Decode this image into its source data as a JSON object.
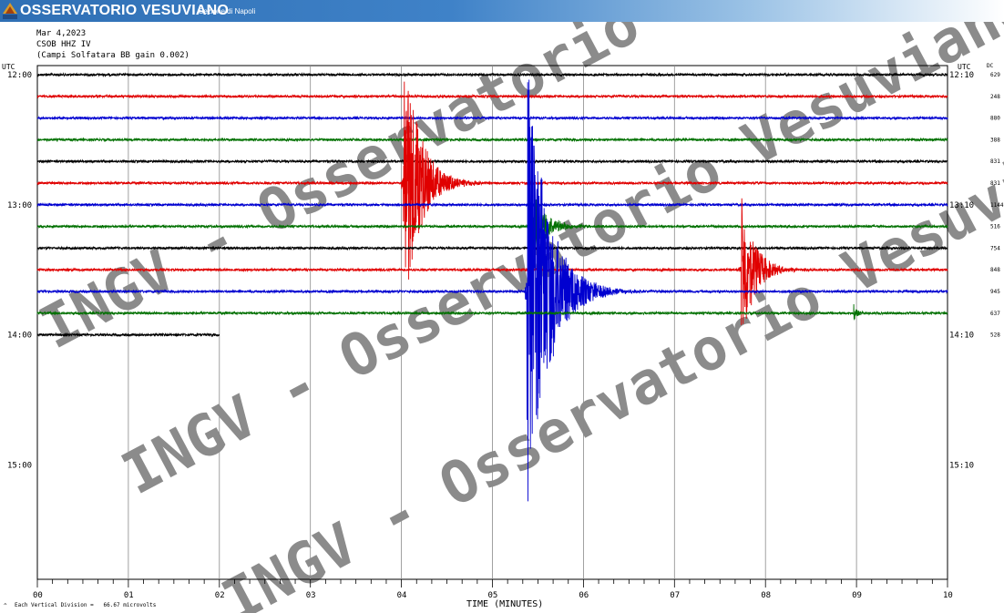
{
  "header": {
    "title": "OSSERVATORIO VESUVIANO",
    "subtitle": "Sezione di Napoli",
    "logo_text": "INGV",
    "brand_color": "#2f6fb4"
  },
  "watermark": "INGV - Osservatorio Vesuviano",
  "chart_data": {
    "type": "seismogram",
    "info_lines": [
      "Mar 4,2023",
      "CSOB HHZ IV",
      "(Campi Solfatara BB gain 0.002)"
    ],
    "left_axis_label": "UTC",
    "right_axis_label": "UTC",
    "dc_label": "DC",
    "left_hour_labels": [
      "12:00",
      "13:00",
      "14:00",
      "15:00"
    ],
    "right_hour_labels": [
      "12:10",
      "13:10",
      "14:10",
      "15:10"
    ],
    "x_tick_labels": [
      "00",
      "01",
      "02",
      "03",
      "04",
      "05",
      "06",
      "07",
      "08",
      "09",
      "10"
    ],
    "xlabel": "TIME (MINUTES)",
    "xlim": [
      0,
      10
    ],
    "footer_note": "Each Vertical Division =   66.67 microvolts",
    "footer_mark": "^",
    "trace_colors": [
      "#000000",
      "#e00000",
      "#0000d0",
      "#007000"
    ],
    "dc_values": [
      "629",
      "248",
      "880",
      "388",
      "831",
      "831",
      "1144",
      "516",
      "754",
      "848",
      "945",
      "637",
      "528"
    ],
    "traces_per_hour": 6,
    "trace_count": 13,
    "last_trace_end_minute": 2,
    "events": [
      {
        "trace": 5,
        "minute": 4.02,
        "amplitude": 160,
        "decay": 0.7
      },
      {
        "trace": 10,
        "minute": 5.38,
        "amplitude": 260,
        "decay": 0.9
      },
      {
        "trace": 7,
        "minute": 5.42,
        "amplitude": 45,
        "decay": 0.6
      },
      {
        "trace": 9,
        "minute": 7.73,
        "amplitude": 90,
        "decay": 0.55
      },
      {
        "trace": 11,
        "minute": 8.97,
        "amplitude": 10,
        "decay": 0.15
      }
    ]
  }
}
